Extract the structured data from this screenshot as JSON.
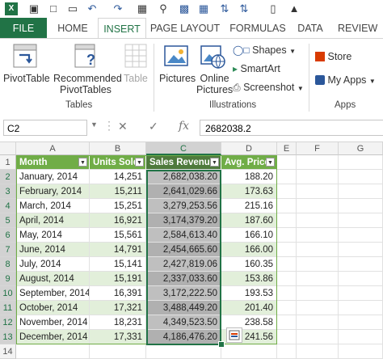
{
  "ribbon": {
    "tabs": [
      {
        "label": "FILE"
      },
      {
        "label": "HOME"
      },
      {
        "label": "INSERT"
      },
      {
        "label": "PAGE LAYOUT"
      },
      {
        "label": "FORMULAS"
      },
      {
        "label": "DATA"
      },
      {
        "label": "REVIEW"
      }
    ],
    "pivottable": "PivotTable",
    "recommended_line1": "Recommended",
    "recommended_line2": "PivotTables",
    "table": "Table",
    "tables_group": "Tables",
    "pictures": "Pictures",
    "online_line1": "Online",
    "online_line2": "Pictures",
    "shapes": "Shapes",
    "smartart": "SmartArt",
    "screenshot": "Screenshot",
    "illustrations_group": "Illustrations",
    "store": "Store",
    "my_apps": "My Apps",
    "apps_group": "Apps"
  },
  "formula_bar": {
    "name_box": "C2",
    "fx": "fx",
    "value": "2682038.2"
  },
  "sheet": {
    "columns": [
      "A",
      "B",
      "C",
      "D",
      "E",
      "F",
      "G"
    ],
    "headers": [
      "Month",
      "Units Sold",
      "Sales Revenue",
      "Avg. Price"
    ],
    "rows": [
      {
        "num": "1"
      },
      {
        "num": "2",
        "month": "January, 2014",
        "units": "14,251",
        "revenue": "2,682,038.20",
        "price": "188.20"
      },
      {
        "num": "3",
        "month": "February, 2014",
        "units": "15,211",
        "revenue": "2,641,029.66",
        "price": "173.63"
      },
      {
        "num": "4",
        "month": "March, 2014",
        "units": "15,251",
        "revenue": "3,279,253.56",
        "price": "215.16"
      },
      {
        "num": "5",
        "month": "April, 2014",
        "units": "16,921",
        "revenue": "3,174,379.20",
        "price": "187.60"
      },
      {
        "num": "6",
        "month": "May, 2014",
        "units": "15,561",
        "revenue": "2,584,613.40",
        "price": "166.10"
      },
      {
        "num": "7",
        "month": "June, 2014",
        "units": "14,791",
        "revenue": "2,454,665.60",
        "price": "166.00"
      },
      {
        "num": "8",
        "month": "July, 2014",
        "units": "15,141",
        "revenue": "2,427,819.06",
        "price": "160.35"
      },
      {
        "num": "9",
        "month": "August, 2014",
        "units": "15,191",
        "revenue": "2,337,033.60",
        "price": "153.86"
      },
      {
        "num": "10",
        "month": "September, 2014",
        "units": "16,391",
        "revenue": "3,172,222.50",
        "price": "193.53"
      },
      {
        "num": "11",
        "month": "October, 2014",
        "units": "17,321",
        "revenue": "3,488,449.20",
        "price": "201.40"
      },
      {
        "num": "12",
        "month": "November, 2014",
        "units": "18,231",
        "revenue": "4,349,523.50",
        "price": "238.58"
      },
      {
        "num": "13",
        "month": "December, 2014",
        "units": "17,331",
        "revenue": "4,186,476.20",
        "price": "241.56"
      },
      {
        "num": "14"
      }
    ]
  }
}
